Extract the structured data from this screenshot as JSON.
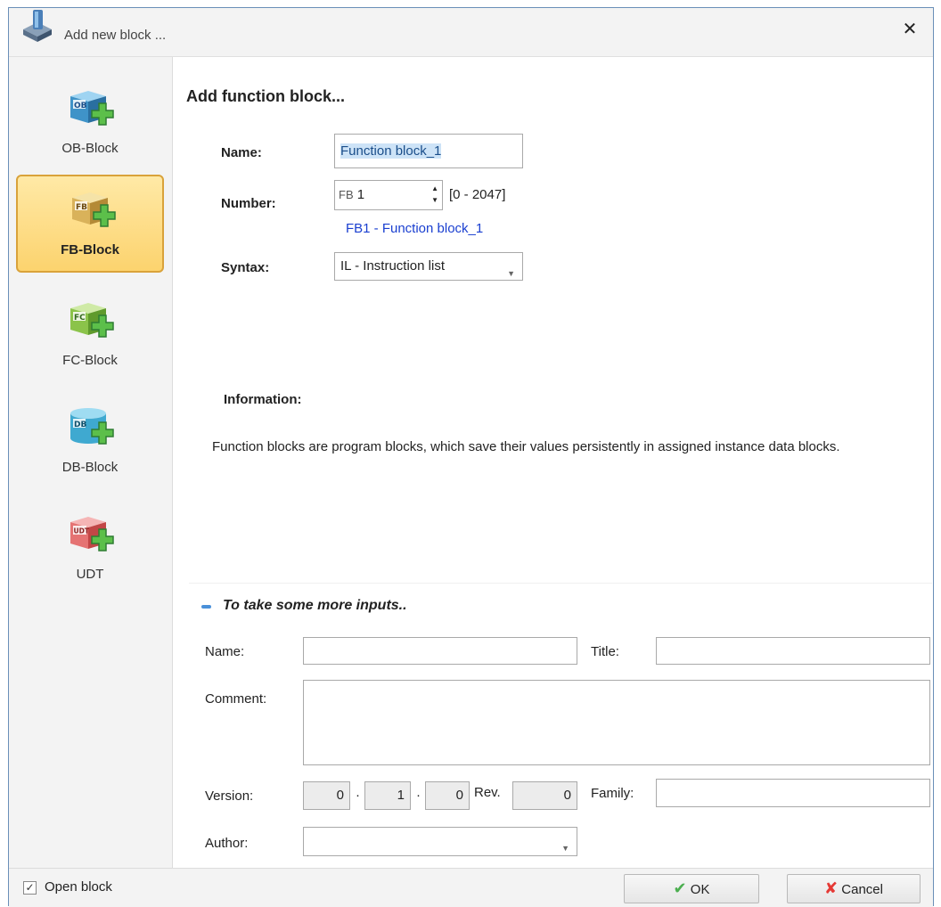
{
  "window": {
    "title": "Add new block ...",
    "close_label": "✕"
  },
  "sidebar": {
    "items": [
      {
        "label": "OB-Block",
        "icon": "ob-block-icon",
        "color": "#4aa3d8",
        "tag": "OB",
        "selected": false
      },
      {
        "label": "FB-Block",
        "icon": "fb-block-icon",
        "color": "#e3c066",
        "tag": "FB",
        "selected": true
      },
      {
        "label": "FC-Block",
        "icon": "fc-block-icon",
        "color": "#8bc34a",
        "tag": "FC",
        "selected": false
      },
      {
        "label": "DB-Block",
        "icon": "db-block-icon",
        "color": "#4ab3d8",
        "tag": "DB",
        "selected": false
      },
      {
        "label": "UDT",
        "icon": "udt-block-icon",
        "color": "#e57373",
        "tag": "UDT",
        "selected": false
      }
    ]
  },
  "form": {
    "heading": "Add function block...",
    "name_label": "Name:",
    "name_value": "Function block_1",
    "number_label": "Number:",
    "number_prefix": "FB",
    "number_value": "1",
    "number_range": "[0 - 2047]",
    "block_link": "FB1 - Function block_1",
    "syntax_label": "Syntax:",
    "syntax_value": "IL - Instruction list",
    "info_label": "Information:",
    "info_text": "Function blocks are program blocks, which save their values persistently in assigned instance data blocks."
  },
  "more_inputs": {
    "toggle_label": "To take some more inputs..",
    "name_label": "Name:",
    "name_value": "",
    "title_label": "Title:",
    "title_value": "",
    "comment_label": "Comment:",
    "comment_value": "",
    "version_label": "Version:",
    "version_major": "0",
    "version_minor": "1",
    "version_patch": "0",
    "version_sep": "·",
    "rev_label": "Rev.",
    "rev_value": "0",
    "family_label": "Family:",
    "family_value": "",
    "author_label": "Author:",
    "author_value": ""
  },
  "footer": {
    "open_block_label": "Open block",
    "open_block_checked": true,
    "ok_label": "OK",
    "cancel_label": "Cancel"
  },
  "colors": {
    "accent_blue": "#1a3fd0",
    "selected_bg": "#fcd36e",
    "ok_green": "#4caf50",
    "cancel_red": "#e53935"
  }
}
